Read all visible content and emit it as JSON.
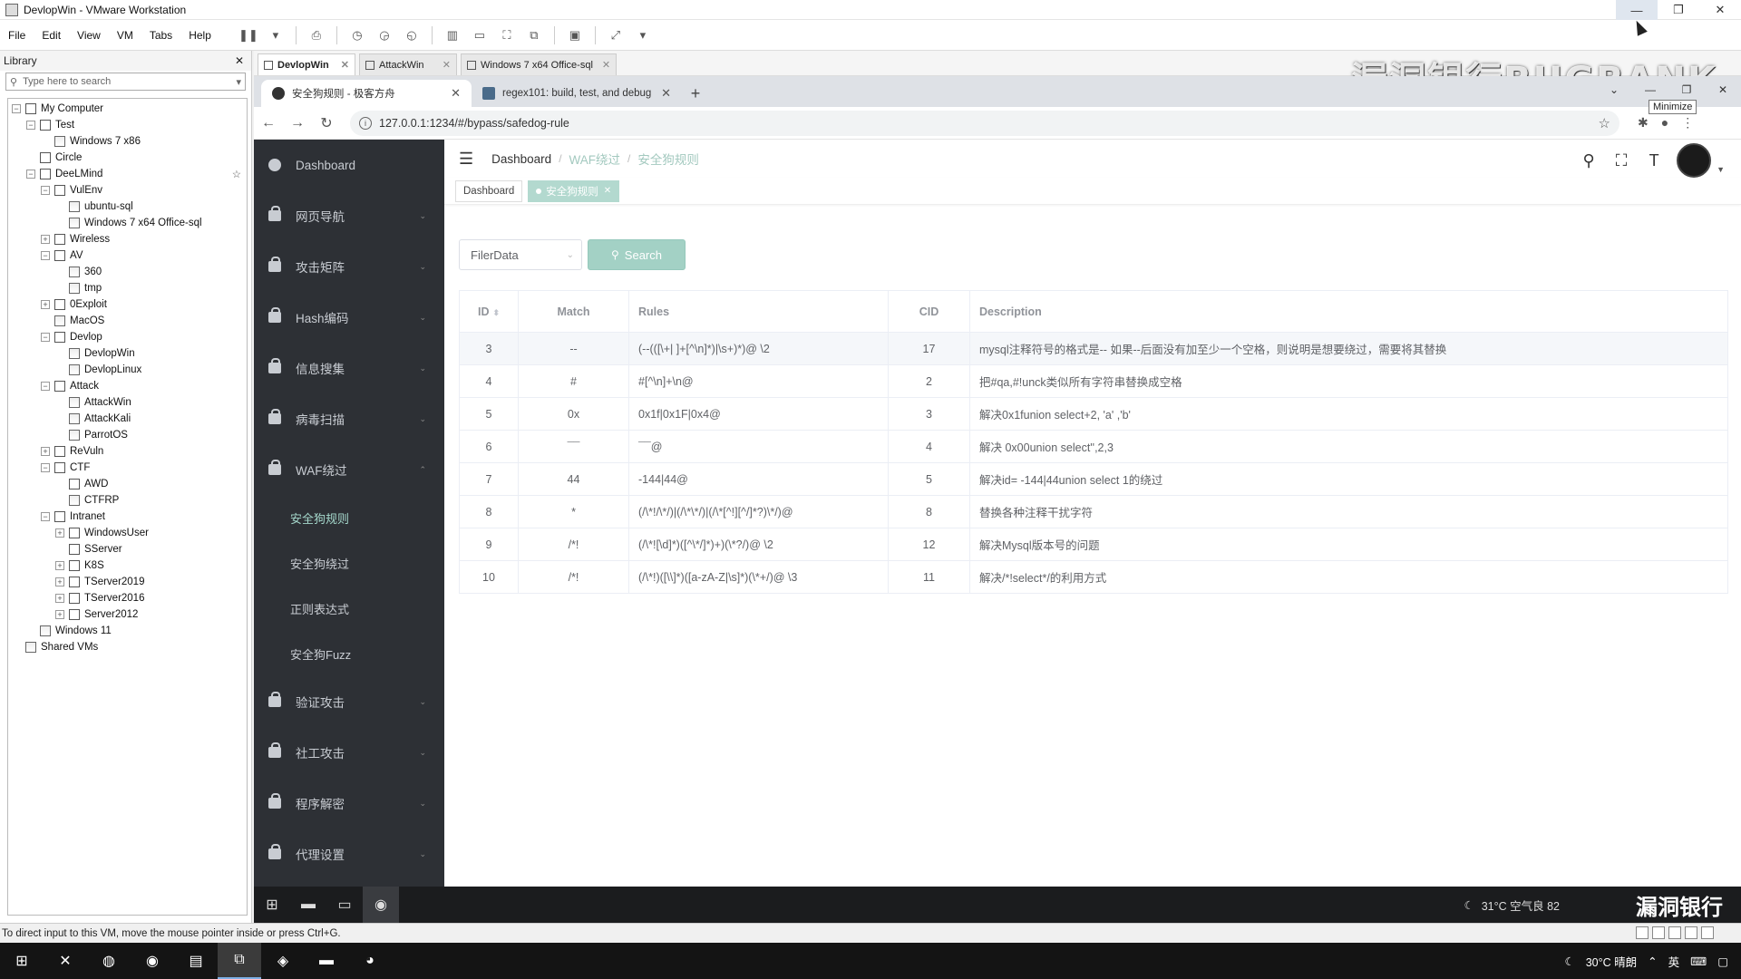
{
  "vmware": {
    "title": "DevlopWin - VMware Workstation",
    "tooltip": "Minimize",
    "menu": [
      "File",
      "Edit",
      "View",
      "VM",
      "Tabs",
      "Help"
    ],
    "status": "To direct input to this VM, move the mouse pointer inside or press Ctrl+G."
  },
  "library": {
    "title": "Library",
    "search_placeholder": "Type here to search",
    "tree": [
      {
        "label": "My Computer",
        "indent": 0,
        "exp": "−",
        "type": "computer"
      },
      {
        "label": "Test",
        "indent": 1,
        "exp": "−",
        "type": "folder"
      },
      {
        "label": "Windows 7 x86",
        "indent": 2,
        "exp": "",
        "type": "vm"
      },
      {
        "label": "Circle",
        "indent": 1,
        "exp": "",
        "type": "folder"
      },
      {
        "label": "DeeLMind",
        "indent": 1,
        "exp": "−",
        "type": "folder",
        "star": true
      },
      {
        "label": "VulEnv",
        "indent": 2,
        "exp": "−",
        "type": "folder"
      },
      {
        "label": "ubuntu-sql",
        "indent": 3,
        "exp": "",
        "type": "vm"
      },
      {
        "label": "Windows 7 x64 Office-sql",
        "indent": 3,
        "exp": "",
        "type": "vm"
      },
      {
        "label": "Wireless",
        "indent": 2,
        "exp": "+",
        "type": "folder"
      },
      {
        "label": "AV",
        "indent": 2,
        "exp": "−",
        "type": "folder"
      },
      {
        "label": "360",
        "indent": 3,
        "exp": "",
        "type": "vm"
      },
      {
        "label": "tmp",
        "indent": 3,
        "exp": "",
        "type": "vm"
      },
      {
        "label": "0Exploit",
        "indent": 2,
        "exp": "+",
        "type": "folder"
      },
      {
        "label": "MacOS",
        "indent": 2,
        "exp": "",
        "type": "vm"
      },
      {
        "label": "Devlop",
        "indent": 2,
        "exp": "−",
        "type": "folder"
      },
      {
        "label": "DevlopWin",
        "indent": 3,
        "exp": "",
        "type": "vm"
      },
      {
        "label": "DevlopLinux",
        "indent": 3,
        "exp": "",
        "type": "vm"
      },
      {
        "label": "Attack",
        "indent": 2,
        "exp": "−",
        "type": "folder"
      },
      {
        "label": "AttackWin",
        "indent": 3,
        "exp": "",
        "type": "vm"
      },
      {
        "label": "AttackKali",
        "indent": 3,
        "exp": "",
        "type": "vm"
      },
      {
        "label": "ParrotOS",
        "indent": 3,
        "exp": "",
        "type": "vm"
      },
      {
        "label": "ReVuln",
        "indent": 2,
        "exp": "+",
        "type": "folder"
      },
      {
        "label": "CTF",
        "indent": 2,
        "exp": "−",
        "type": "folder"
      },
      {
        "label": "AWD",
        "indent": 3,
        "exp": "",
        "type": "folder"
      },
      {
        "label": "CTFRP",
        "indent": 3,
        "exp": "",
        "type": "vm"
      },
      {
        "label": "Intranet",
        "indent": 2,
        "exp": "−",
        "type": "folder"
      },
      {
        "label": "WindowsUser",
        "indent": 3,
        "exp": "+",
        "type": "folder"
      },
      {
        "label": "SServer",
        "indent": 3,
        "exp": "",
        "type": "folder"
      },
      {
        "label": "K8S",
        "indent": 3,
        "exp": "+",
        "type": "folder"
      },
      {
        "label": "TServer2019",
        "indent": 3,
        "exp": "+",
        "type": "folder"
      },
      {
        "label": "TServer2016",
        "indent": 3,
        "exp": "+",
        "type": "folder"
      },
      {
        "label": "Server2012",
        "indent": 3,
        "exp": "+",
        "type": "folder"
      },
      {
        "label": "Windows 11",
        "indent": 1,
        "exp": "",
        "type": "vm"
      },
      {
        "label": "Shared VMs",
        "indent": 0,
        "exp": "",
        "type": "vm"
      }
    ]
  },
  "vm_tabs": [
    {
      "label": "DevlopWin",
      "active": true
    },
    {
      "label": "AttackWin",
      "active": false
    },
    {
      "label": "Windows 7 x64 Office-sql",
      "active": false
    }
  ],
  "watermark": "漏洞银行BUGBANK",
  "chrome": {
    "tabs": [
      {
        "label": "安全狗规则 - 极客方舟",
        "active": true,
        "favicon": "circle"
      },
      {
        "label": "regex101: build, test, and debug",
        "active": false,
        "favicon": "square"
      }
    ],
    "url": "127.0.0.1:1234/#/bypass/safedog-rule"
  },
  "sidebar": {
    "items": [
      {
        "label": "Dashboard",
        "icon": "dashboard-icon",
        "arrow": ""
      },
      {
        "label": "网页导航",
        "icon": "lock-icon",
        "arrow": "⌄"
      },
      {
        "label": "攻击矩阵",
        "icon": "lock-icon",
        "arrow": "⌄"
      },
      {
        "label": "Hash编码",
        "icon": "lock-icon",
        "arrow": "⌄"
      },
      {
        "label": "信息搜集",
        "icon": "lock-icon",
        "arrow": "⌄"
      },
      {
        "label": "病毒扫描",
        "icon": "lock-icon",
        "arrow": "⌄"
      },
      {
        "label": "WAF绕过",
        "icon": "lock-icon",
        "arrow": "⌃"
      }
    ],
    "sub_items": [
      {
        "label": "安全狗规则",
        "active": true
      },
      {
        "label": "安全狗绕过",
        "active": false
      },
      {
        "label": "正则表达式",
        "active": false
      },
      {
        "label": "安全狗Fuzz",
        "active": false
      }
    ],
    "items_after": [
      {
        "label": "验证攻击",
        "icon": "lock-icon",
        "arrow": "⌄"
      },
      {
        "label": "社工攻击",
        "icon": "lock-icon",
        "arrow": "⌄"
      },
      {
        "label": "程序解密",
        "icon": "lock-icon",
        "arrow": "⌄"
      },
      {
        "label": "代理设置",
        "icon": "lock-icon",
        "arrow": "⌄"
      }
    ]
  },
  "breadcrumb": {
    "home": "Dashboard",
    "level1": "WAF绕过",
    "level2": "安全狗规则"
  },
  "tags": {
    "dashboard": "Dashboard",
    "active": "安全狗规则"
  },
  "filter": {
    "select_value": "FilerData",
    "search_label": "Search"
  },
  "table": {
    "headers": {
      "id": "ID",
      "match": "Match",
      "rules": "Rules",
      "cid": "CID",
      "description": "Description"
    },
    "rows": [
      {
        "id": "3",
        "match": "--",
        "rules": "(--(([\\+| ]+[^\\n]*)|\\s+)*)@ \\2",
        "cid": "17",
        "description": "mysql注释符号的格式是-- 如果--后面没有加至少一个空格，则说明是想要绕过，需要将其替换"
      },
      {
        "id": "4",
        "match": "#",
        "rules": "#[^\\n]+\\n@",
        "cid": "2",
        "description": "把#qa,#!unck类似所有字符串替换成空格"
      },
      {
        "id": "5",
        "match": "0x",
        "rules": "0x1f|0x1F|0x4@",
        "cid": "3",
        "description": "解决0x1funion select+2, 'a' ,'b'"
      },
      {
        "id": "6",
        "match": "¯¯",
        "rules": "¯¯@",
        "cid": "4",
        "description": "解决 0x00union select'',2,3"
      },
      {
        "id": "7",
        "match": "44",
        "rules": "-144|44@",
        "cid": "5",
        "description": "解决id= -144|44union select 1的绕过"
      },
      {
        "id": "8",
        "match": "*",
        "rules": "(/\\*!/\\*/)|(/\\*\\*/)|(/\\*[^!][^/]*?)\\*/)@",
        "cid": "8",
        "description": "替换各种注释干扰字符"
      },
      {
        "id": "9",
        "match": "/*!",
        "rules": "(/\\*![\\d]*)([^\\*/]*)+)(\\*?/)@ \\2",
        "cid": "12",
        "description": "解决Mysql版本号的问题"
      },
      {
        "id": "10",
        "match": "/*!",
        "rules": "(/\\*!)([\\\\]*)([a-zA-Z|\\s]*)(\\*+/)@ \\3",
        "cid": "11",
        "description": "解决/*!select*/的利用方式"
      }
    ]
  },
  "guest_taskbar": {
    "weather": "31°C  空气良 82",
    "logo": "漏洞银行"
  },
  "host_taskbar": {
    "weather": "30°C  晴朗",
    "ime": "英"
  }
}
